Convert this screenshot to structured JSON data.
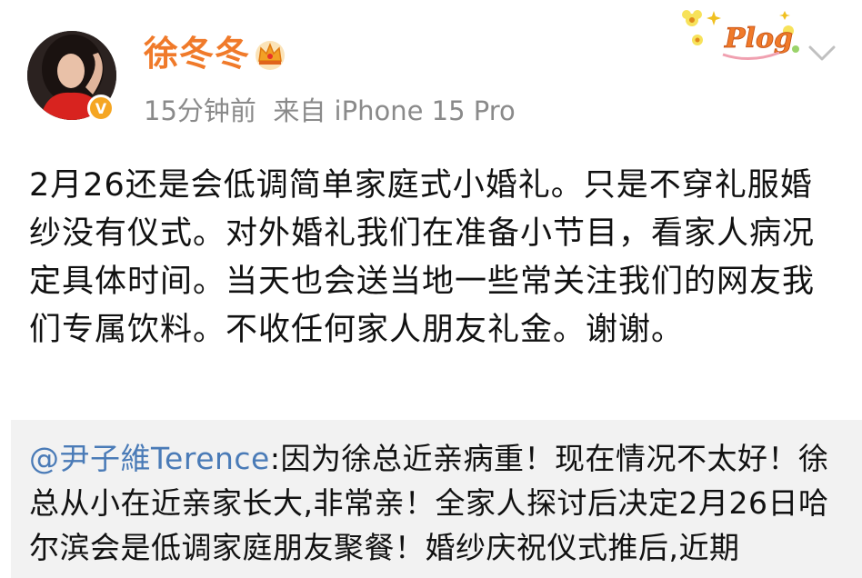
{
  "header": {
    "user_name": "徐冬冬",
    "time": "15分钟前",
    "source": "来自 iPhone 15 Pro",
    "decor_text": "Plog"
  },
  "post": {
    "text": "2月26还是会低调简单家庭式小婚礼。只是不穿礼服婚纱没有仪式。对外婚礼我们在准备小节目，看家人病况定具体时间。当天也会送当地一些常关注我们的网友我们专属饮料。不收任何家人朋友礼金。谢谢。"
  },
  "repost": {
    "mention": "@尹子維Terence",
    "text": ":因为徐总近亲病重！现在情况不太好！徐总从小在近亲家长大,非常亲！全家人探讨后决定2月26日哈尔滨会是低调家庭朋友聚餐！婚纱庆祝仪式推后,近期"
  },
  "colors": {
    "name": "#f07a2a",
    "mention": "#4a7bb7",
    "meta": "#8a8a8a",
    "repost_bg": "#f2f2f2"
  },
  "icons": [
    "crown-icon",
    "verified-icon",
    "chevron-down-icon",
    "avatar"
  ]
}
